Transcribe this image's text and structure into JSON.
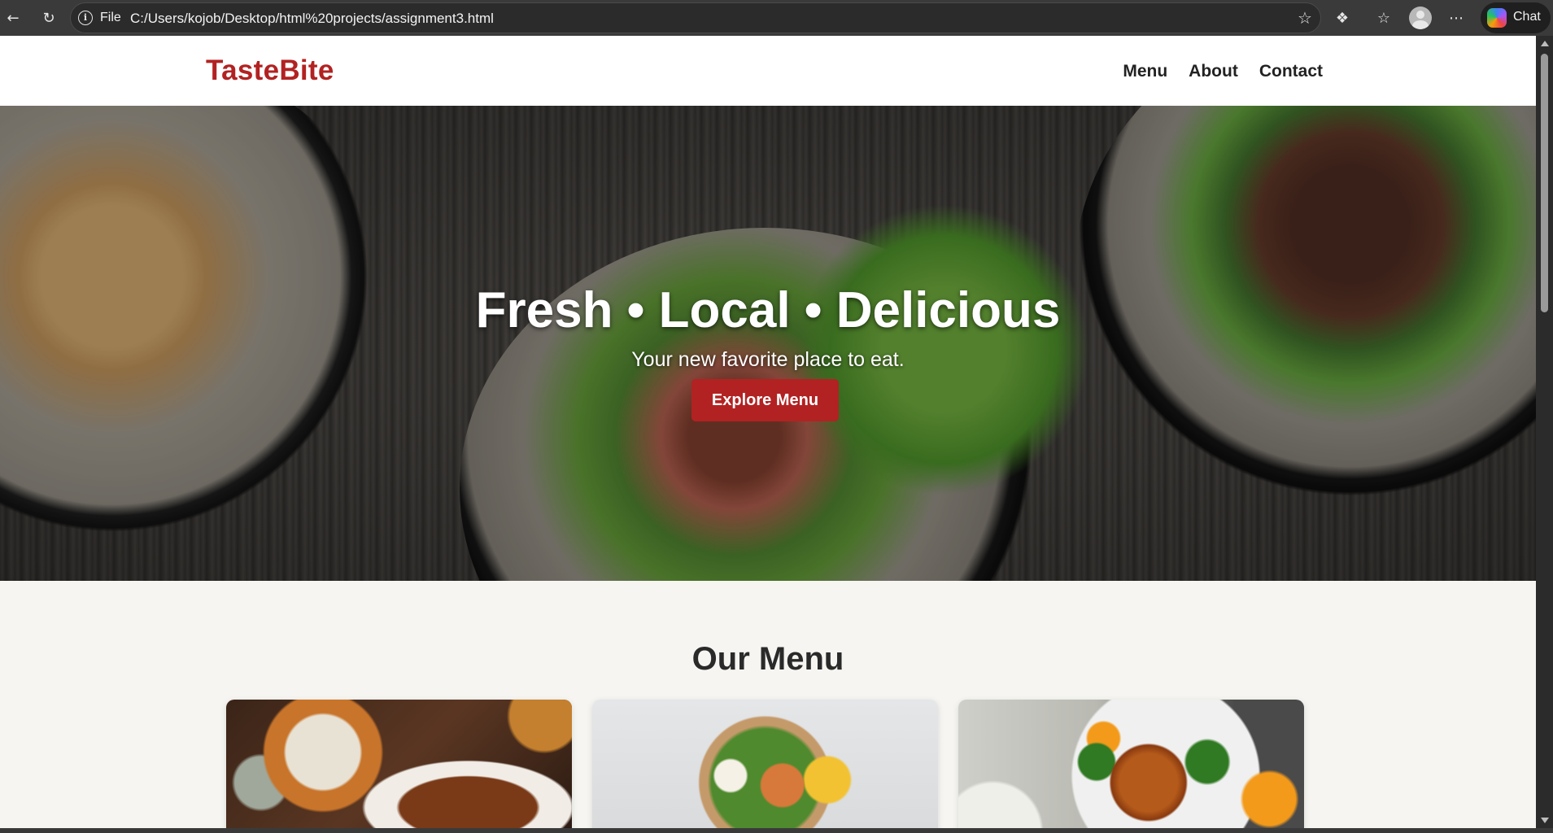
{
  "browser": {
    "scheme_label": "File",
    "url": "C:/Users/kojob/Desktop/html%20projects/assignment3.html",
    "chat_label": "Chat"
  },
  "site": {
    "brand": "TasteBite",
    "nav": [
      "Menu",
      "About",
      "Contact"
    ]
  },
  "hero": {
    "title": "Fresh • Local • Delicious",
    "subtitle": "Your new favorite place to eat.",
    "button_label": "Explore Menu"
  },
  "menu_section": {
    "title": "Our Menu",
    "cards": [
      {
        "image": "assorted-dishes-image"
      },
      {
        "image": "salad-bowl-image"
      },
      {
        "image": "orange-chicken-image"
      }
    ]
  },
  "colors": {
    "brand": "#b22222",
    "page_bg": "#f6f5f2",
    "chrome_bg": "#3a3a3a"
  }
}
